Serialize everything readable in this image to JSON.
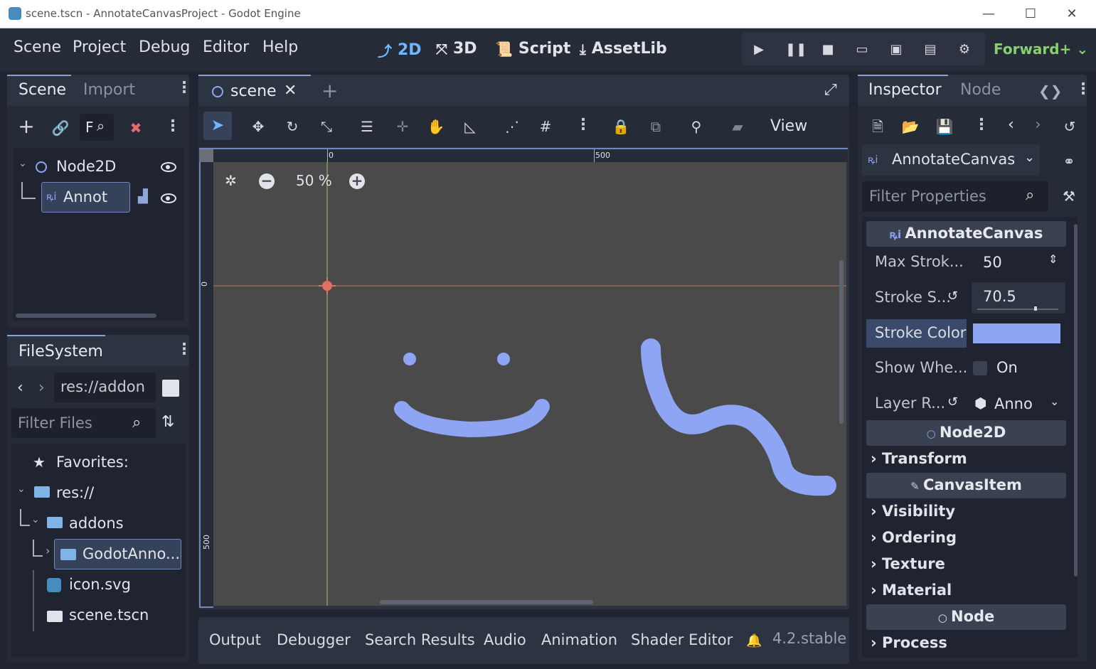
{
  "window": {
    "title": "scene.tscn - AnnotateCanvasProject - Godot Engine",
    "minimize": "—",
    "maximize": "☐",
    "close": "✕"
  },
  "menu": [
    "Scene",
    "Project",
    "Debug",
    "Editor",
    "Help"
  ],
  "workspaces": [
    {
      "label": "2D",
      "icon": "2d-icon"
    },
    {
      "label": "3D",
      "icon": "3d-icon"
    },
    {
      "label": "Script",
      "icon": "script-icon"
    },
    {
      "label": "AssetLib",
      "icon": "assetlib-icon"
    }
  ],
  "renderer": "Forward+",
  "scene_dock": {
    "tabs": [
      "Scene",
      "Import"
    ],
    "filter_label": "F",
    "tree": [
      {
        "label": "Node2D",
        "icon": "node2d-icon"
      },
      {
        "label": "Annot",
        "icon": "annotate-canvas-icon",
        "selected": true
      }
    ]
  },
  "filesystem": {
    "tab": "FileSystem",
    "path": "res://addon",
    "filter_placeholder": "Filter Files",
    "favorites": "Favorites:",
    "items": [
      {
        "label": "res://",
        "icon": "folder-icon"
      },
      {
        "label": "addons",
        "icon": "folder-icon"
      },
      {
        "label": "GodotAnno...",
        "icon": "folder-icon",
        "selected": true
      },
      {
        "label": "icon.svg",
        "icon": "svg-file-icon"
      },
      {
        "label": "scene.tscn",
        "icon": "scene-file-icon"
      }
    ]
  },
  "editor": {
    "scene_tab": "scene",
    "view_menu": "View",
    "zoom": "50 %",
    "ruler_h": [
      "0",
      "500"
    ],
    "ruler_v": [
      "0",
      "500"
    ]
  },
  "canvas": {
    "stroke_color": "#8da5f3",
    "background": "#4a4a4a"
  },
  "inspector": {
    "tabs": [
      "Inspector",
      "Node"
    ],
    "object": "AnnotateCanvas",
    "filter_placeholder": "Filter Properties",
    "class_header": "AnnotateCanvas",
    "props": {
      "max_stroke_label": "Max Strok...",
      "max_stroke_value": "50",
      "stroke_size_label": "Stroke S...",
      "stroke_size_value": "70.5",
      "stroke_size_fraction": 0.705,
      "stroke_color_label": "Stroke Color",
      "stroke_color_value": "#8da5f3",
      "show_when_label": "Show Whe...",
      "show_when_value": "On",
      "layer_label": "Layer R...",
      "layer_value": "Anno"
    },
    "node2d_header": "Node2D",
    "node2d_sections": [
      "Transform"
    ],
    "canvasitem_header": "CanvasItem",
    "canvasitem_sections": [
      "Visibility",
      "Ordering",
      "Texture",
      "Material"
    ],
    "node_header": "Node",
    "node_sections": [
      "Process"
    ]
  },
  "bottom_panel": {
    "tabs": [
      "Output",
      "Debugger",
      "Search Results",
      "Audio",
      "Animation",
      "Shader Editor"
    ],
    "version": "4.2.stable"
  }
}
